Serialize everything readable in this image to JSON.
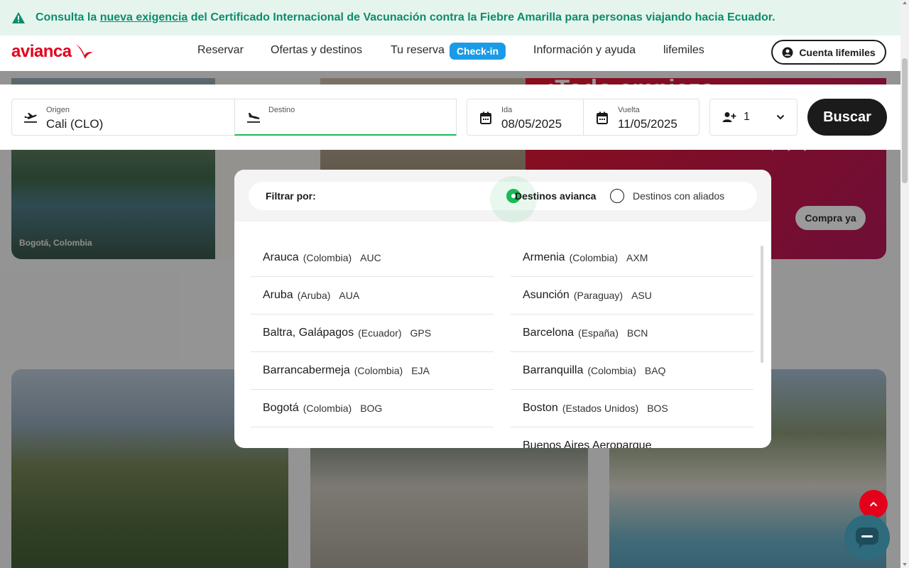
{
  "alert": {
    "pre": "Consulta la ",
    "link": "nueva exigencia",
    "post": " del Certificado Internacional de Vacunación contra la Fiebre Amarilla para personas viajando hacia Ecuador.",
    "icon": "warning-icon"
  },
  "header": {
    "logo": "avianca",
    "nav": [
      "Reservar",
      "Ofertas y destinos",
      "Tu reserva",
      "Información y ayuda",
      "lifemiles"
    ],
    "checkin": "Check-in",
    "account": "Cuenta lifemiles"
  },
  "hero": {
    "caption": "Bogotá, Colombia",
    "headline": "¡Todo empieza",
    "sub": "playa y Caribe",
    "cta": "Compra ya"
  },
  "search": {
    "origin_label": "Origen",
    "origin_value": "Cali  (CLO)",
    "dest_label": "Destino",
    "dest_value": "",
    "ida_label": "Ida",
    "ida_value": "08/05/2025",
    "vuelta_label": "Vuelta",
    "vuelta_value": "11/05/2025",
    "passengers": "1",
    "button": "Buscar"
  },
  "dropdown": {
    "filter_label": "Filtrar por:",
    "option_avianca": "Destinos avianca",
    "option_aliados": "Destinos con aliados",
    "selected": "Destinos avianca",
    "left": [
      {
        "city": "Arauca",
        "country": "(Colombia)",
        "code": "AUC"
      },
      {
        "city": "Aruba",
        "country": "(Aruba)",
        "code": "AUA"
      },
      {
        "city": "Baltra, Galápagos",
        "country": "(Ecuador)",
        "code": "GPS"
      },
      {
        "city": "Barrancabermeja",
        "country": "(Colombia)",
        "code": "EJA"
      },
      {
        "city": "Bogotá",
        "country": "(Colombia)",
        "code": "BOG"
      }
    ],
    "right": [
      {
        "city": "Armenia",
        "country": "(Colombia)",
        "code": "AXM"
      },
      {
        "city": "Asunción",
        "country": "(Paraguay)",
        "code": "ASU"
      },
      {
        "city": "Barcelona",
        "country": "(España)",
        "code": "BCN"
      },
      {
        "city": "Barranquilla",
        "country": "(Colombia)",
        "code": "BAQ"
      },
      {
        "city": "Boston",
        "country": "(Estados Unidos)",
        "code": "BOS"
      },
      {
        "city": "Buenos Aires Aeroparque",
        "country": "",
        "code": ""
      }
    ]
  },
  "colors": {
    "brand_red": "#e3001b",
    "accent_green": "#1db954",
    "checkin_blue": "#1b9be5",
    "alert_text": "#0e8b6e",
    "alert_bg": "#e5f5ee"
  }
}
